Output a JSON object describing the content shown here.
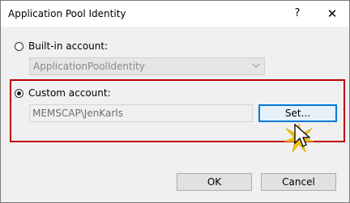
{
  "window": {
    "title": "Application Pool Identity",
    "help_glyph": "?",
    "close_glyph": "✕"
  },
  "builtin": {
    "label": "Built-in account:",
    "selected": false,
    "dropdown_value": "ApplicationPoolIdentity"
  },
  "custom": {
    "label": "Custom account:",
    "selected": true,
    "value": "MEMSCAP\\JenKarls",
    "set_label": "Set..."
  },
  "footer": {
    "ok_label": "OK",
    "cancel_label": "Cancel"
  },
  "colors": {
    "highlight": "#c00000",
    "focus": "#0078d7",
    "spark": "#f5c400"
  },
  "icons": {
    "cursor": "arrow-cursor-icon",
    "spark": "click-spark-icon",
    "dropdown": "chevron-down-icon"
  }
}
